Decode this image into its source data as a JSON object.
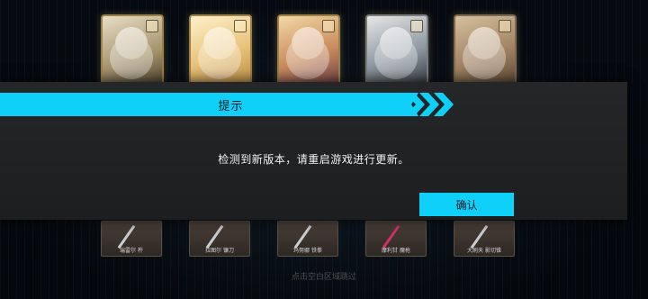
{
  "dialog": {
    "title": "提示",
    "message": "检测到新版本，请重启游戏进行更新。",
    "confirm_label": "确认"
  },
  "weapons": [
    {
      "name": "瑞雷尔 杵"
    },
    {
      "name": "拉图尔 镰刀"
    },
    {
      "name": "玛努娜 铁拳"
    },
    {
      "name": "摩利甘 魔枪"
    },
    {
      "name": "大刷天 影切锥"
    }
  ],
  "footer": {
    "hint": "点击空白区域跳过"
  },
  "colors": {
    "accent": "#0fd0f8",
    "dialog_bg": "#1f2123"
  }
}
